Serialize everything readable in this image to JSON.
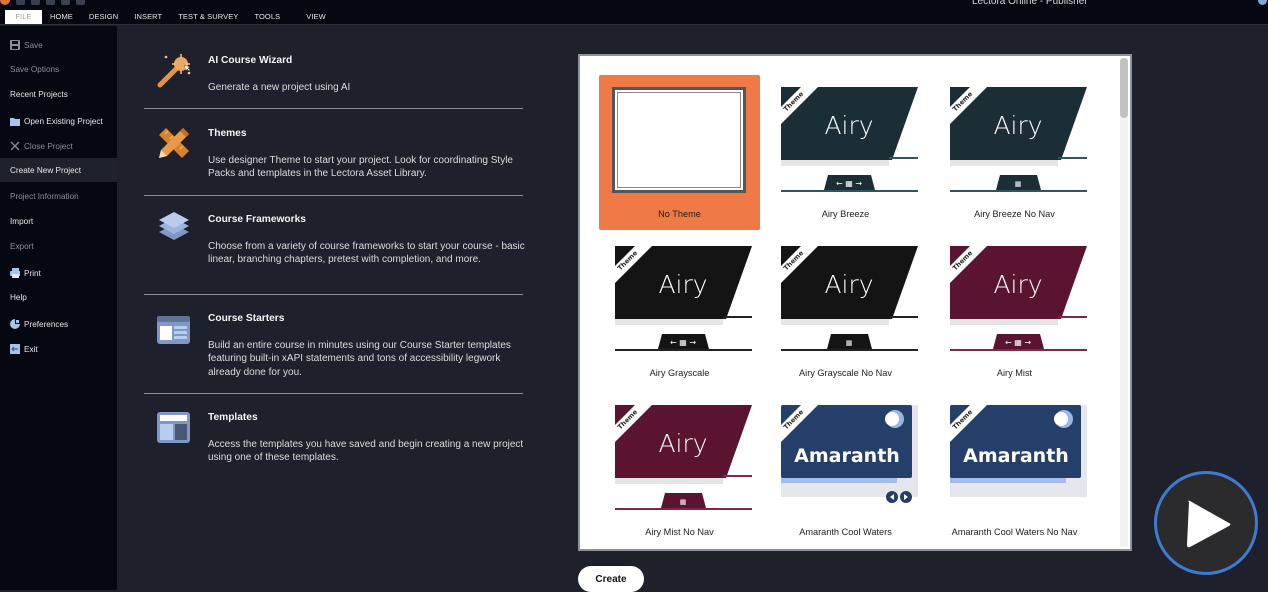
{
  "app": {
    "title": "Lectora Online - Publisher"
  },
  "ribbon": {
    "tabs": [
      {
        "label": "FILE",
        "active": true
      },
      {
        "label": "HOME"
      },
      {
        "label": "DESIGN"
      },
      {
        "label": "INSERT"
      },
      {
        "label": "TEST & SURVEY"
      },
      {
        "label": "TOOLS"
      },
      {
        "label": "VIEW"
      }
    ]
  },
  "sidebar": {
    "items": [
      {
        "label": "Save",
        "icon": "save-icon",
        "dim": true
      },
      {
        "label": "Save Options",
        "dim": true
      },
      {
        "label": "Recent Projects"
      },
      {
        "label": "Open Existing Project",
        "icon": "folder-icon"
      },
      {
        "label": "Close Project",
        "icon": "close-icon",
        "dim": true
      },
      {
        "label": "Create New Project",
        "active": true
      },
      {
        "label": "Project Information",
        "dim": true
      },
      {
        "label": "Import"
      },
      {
        "label": "Export",
        "dim": true
      },
      {
        "label": "Print",
        "icon": "printer-icon"
      },
      {
        "label": "Help"
      },
      {
        "label": "Preferences",
        "icon": "preferences-icon"
      },
      {
        "label": "Exit",
        "icon": "exit-icon"
      }
    ]
  },
  "options": [
    {
      "title": "AI Course Wizard",
      "description": "Generate a new project using AI",
      "icon": "magic-wand-icon"
    },
    {
      "title": "Themes",
      "description": "Use designer Theme to start your project. Look for coordinating Style Packs and templates in the Lectora Asset Library.",
      "icon": "ruler-pencil-icon"
    },
    {
      "title": "Course Frameworks",
      "description": "Choose from a variety of course frameworks to start your course - basic linear, branching chapters, pretest with completion, and more.",
      "icon": "layers-icon"
    },
    {
      "title": "Course Starters",
      "description": "Build an entire course in minutes using our Course Starter templates featuring built-in xAPI statements and tons of accessibility legwork already done for you.",
      "icon": "course-starter-icon"
    },
    {
      "title": "Templates",
      "description": "Access the templates you have saved and begin creating a new project using one of these templates.",
      "icon": "template-icon"
    }
  ],
  "themes": {
    "badge": "Theme",
    "items": [
      {
        "label": "No Theme",
        "selected": true,
        "kind": "none"
      },
      {
        "label": "Airy Breeze",
        "kind": "airy",
        "color": "#1b2e36",
        "accent": "#2e5563",
        "nav": "full",
        "wordmark": "Airy"
      },
      {
        "label": "Airy Breeze No Nav",
        "kind": "airy",
        "color": "#1b2e36",
        "accent": "#2e5563",
        "nav": "menu",
        "wordmark": "Airy"
      },
      {
        "label": "Airy Grayscale",
        "kind": "airy",
        "color": "#141414",
        "accent": "#222222",
        "nav": "full",
        "wordmark": "Airy"
      },
      {
        "label": "Airy Grayscale No Nav",
        "kind": "airy",
        "color": "#141414",
        "accent": "#222222",
        "nav": "menu",
        "wordmark": "Airy"
      },
      {
        "label": "Airy Mist",
        "kind": "airy",
        "color": "#5a1432",
        "accent": "#7a2a48",
        "nav": "full",
        "wordmark": "Airy"
      },
      {
        "label": "Airy Mist No Nav",
        "kind": "airy",
        "color": "#5a1432",
        "accent": "#7a2a48",
        "nav": "menu",
        "wordmark": "Airy"
      },
      {
        "label": "Amaranth Cool Waters",
        "kind": "amaranth",
        "color": "#24406a",
        "nav": "arrows",
        "wordmark": "Amaranth"
      },
      {
        "label": "Amaranth Cool Waters No Nav",
        "kind": "amaranth",
        "color": "#24406a",
        "nav": "none",
        "wordmark": "Amaranth"
      }
    ]
  },
  "actions": {
    "create_label": "Create"
  },
  "colors": {
    "accent_orange": "#ef7a45",
    "play_ring": "#3f7bd1"
  }
}
